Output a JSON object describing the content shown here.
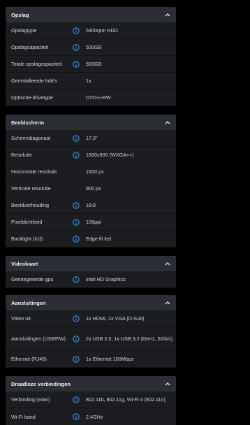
{
  "sections": [
    {
      "title": "Opslag",
      "rows": [
        {
          "label": "Opslagtype",
          "info": true,
          "value": "5400rpm HDD"
        },
        {
          "label": "Opslagcapaciteit",
          "info": true,
          "value": "500GB"
        },
        {
          "label": "Totale opslagcapaciteit",
          "info": true,
          "value": "500GB"
        },
        {
          "label": "Geïnstalleerde hdd's",
          "info": false,
          "value": "1x"
        },
        {
          "label": "Optische-drivetype",
          "info": false,
          "value": "DVD+/-RW"
        }
      ]
    },
    {
      "title": "Beeldscherm",
      "rows": [
        {
          "label": "Schermdiagonaal",
          "info": true,
          "value": "17.3\""
        },
        {
          "label": "Resolutie",
          "info": true,
          "value": "1600x900 (WXGA++)"
        },
        {
          "label": "Horizontale resolutie",
          "info": false,
          "value": "1600 px"
        },
        {
          "label": "Verticale resolutie",
          "info": false,
          "value": "900 px"
        },
        {
          "label": "Beeldverhouding",
          "info": true,
          "value": "16:9"
        },
        {
          "label": "Pixeldichtheid",
          "info": true,
          "value": "106ppi"
        },
        {
          "label": "Backlight (lcd)",
          "info": true,
          "value": "Edge-lit led"
        }
      ]
    },
    {
      "title": "Videokaart",
      "rows": [
        {
          "label": "Geïntegreerde gpu",
          "info": true,
          "value": "Intel HD Graphics"
        }
      ]
    },
    {
      "title": "Aansluitingen",
      "rows": [
        {
          "label": "Video uit",
          "info": true,
          "value": "1x HDMI, 1x VGA (D-Sub)"
        },
        {
          "label": "Aansluitingen (USB/FW)",
          "info": true,
          "value": "2x USB 2.0, 1x USB 3.2 (Gen1, 5Gb/s)"
        },
        {
          "label": "Ethernet (RJ45)",
          "info": true,
          "value": "1x Ethernet 100Mbps"
        }
      ]
    },
    {
      "title": "Draadloze verbindingen",
      "rows": [
        {
          "label": "Verbinding (wlan)",
          "info": true,
          "value": "802.11b, 802.11g, Wi-Fi 4 (802.11n)"
        },
        {
          "label": "Wi-Fi band",
          "info": true,
          "value": "2,4GHz"
        }
      ]
    }
  ]
}
